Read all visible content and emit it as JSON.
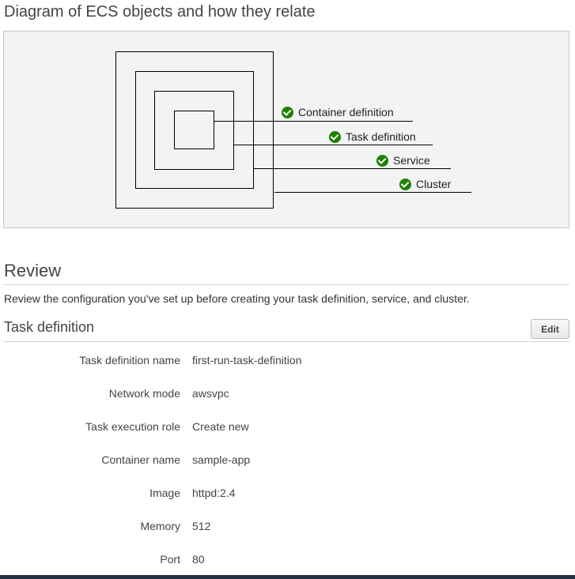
{
  "diagram": {
    "title": "Diagram of ECS objects and how they relate",
    "legend": [
      {
        "label": "Container definition",
        "icon": "check-circle-icon"
      },
      {
        "label": "Task definition",
        "icon": "check-circle-icon"
      },
      {
        "label": "Service",
        "icon": "check-circle-icon"
      },
      {
        "label": "Cluster",
        "icon": "check-circle-icon"
      }
    ],
    "colors": {
      "check": "#1d8102",
      "panel": "#f2f3f3"
    }
  },
  "review": {
    "title": "Review",
    "description": "Review the configuration you've set up before creating your task definition, service, and cluster."
  },
  "task_definition": {
    "title": "Task definition",
    "edit_label": "Edit",
    "fields": [
      {
        "label": "Task definition name",
        "value": "first-run-task-definition"
      },
      {
        "label": "Network mode",
        "value": "awsvpc"
      },
      {
        "label": "Task execution role",
        "value": "Create new"
      },
      {
        "label": "Container name",
        "value": "sample-app"
      },
      {
        "label": "Image",
        "value": "httpd:2.4"
      },
      {
        "label": "Memory",
        "value": "512"
      },
      {
        "label": "Port",
        "value": "80"
      }
    ]
  }
}
